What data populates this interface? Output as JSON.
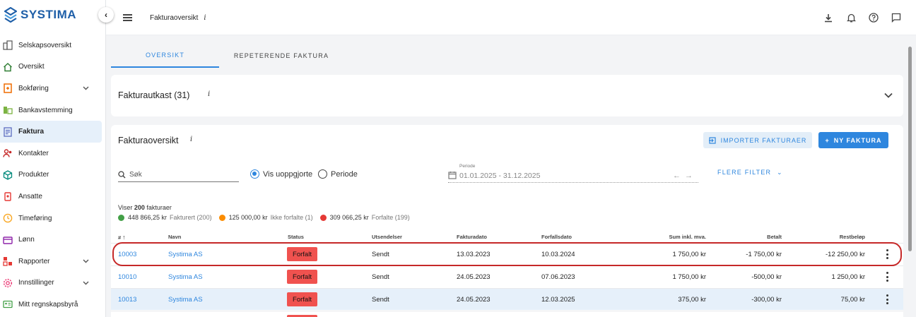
{
  "brand": {
    "name": "SYSTIMA",
    "color": "#1f5fa8"
  },
  "sidebar": {
    "collapse_icon": "chevron-left-icon",
    "items": [
      {
        "label": "Selskapsoversikt",
        "icon": "buildings-icon",
        "color": "#555555"
      },
      {
        "label": "Oversikt",
        "icon": "home-icon",
        "color": "#2e7d32"
      },
      {
        "label": "Bokføring",
        "icon": "ledger-icon",
        "color": "#ef6c00",
        "expandable": true
      },
      {
        "label": "Bankavstemming",
        "icon": "bank-icon",
        "color": "#7cb342"
      },
      {
        "label": "Faktura",
        "icon": "invoice-icon",
        "color": "#5c6bc0",
        "active": true
      },
      {
        "label": "Kontakter",
        "icon": "contacts-icon",
        "color": "#c62828"
      },
      {
        "label": "Produkter",
        "icon": "cube-icon",
        "color": "#00897b"
      },
      {
        "label": "Ansatte",
        "icon": "badge-icon",
        "color": "#e53935"
      },
      {
        "label": "Timeføring",
        "icon": "clock-icon",
        "color": "#f9a825"
      },
      {
        "label": "Lønn",
        "icon": "wallet-icon",
        "color": "#8e24aa"
      },
      {
        "label": "Rapporter",
        "icon": "report-icon",
        "color": "#e53935",
        "expandable": true
      },
      {
        "label": "Innstillinger",
        "icon": "gear-icon",
        "color": "#ec407a",
        "expandable": true
      },
      {
        "label": "Mitt regnskapsbyrå",
        "icon": "id-card-icon",
        "color": "#43a047"
      }
    ]
  },
  "topbar": {
    "title": "Fakturaoversikt",
    "info": "i",
    "icons": [
      "download-icon",
      "bell-icon",
      "help-icon",
      "chat-icon"
    ]
  },
  "tabs": [
    {
      "label": "OVERSIKT",
      "active": true
    },
    {
      "label": "REPETERENDE FAKTURA",
      "active": false
    }
  ],
  "drafts": {
    "title": "Fakturautkast (31)",
    "info": "i"
  },
  "invoices": {
    "title": "Fakturaoversikt",
    "info": "i",
    "import_label": "IMPORTER FAKTURAER",
    "new_label": "NY FAKTURA",
    "search_placeholder": "Søk",
    "radio_unsettled": "Vis uoppgjorte",
    "radio_period": "Periode",
    "period_label": "Periode",
    "period_value": "01.01.2025 - 31.12.2025",
    "more_filter": "FLERE FILTER",
    "showing_prefix": "Viser",
    "showing_count": "200",
    "showing_suffix": "fakturaer",
    "summary": [
      {
        "amount": "448 866,25 kr",
        "label": "Fakturert (200)",
        "color": "#43a047"
      },
      {
        "amount": "125 000,00 kr",
        "label": "Ikke forfalte (1)",
        "color": "#fb8c00"
      },
      {
        "amount": "309 066,25 kr",
        "label": "Forfalte (199)",
        "color": "#e53935"
      }
    ],
    "columns": {
      "number": "#",
      "name": "Navn",
      "status": "Status",
      "sent": "Utsendelser",
      "invoice_date": "Fakturadato",
      "due_date": "Forfallsdato",
      "sum": "Sum inkl. mva.",
      "paid": "Betalt",
      "remaining": "Restbeløp"
    },
    "rows": [
      {
        "number": "10003",
        "name": "Systima AS",
        "status": "Forfalt",
        "sent": "Sendt",
        "invoice_date": "13.03.2023",
        "due_date": "10.03.2024",
        "sum": "1 750,00 kr",
        "paid": "-1 750,00 kr",
        "remaining": "-12 250,00 kr"
      },
      {
        "number": "10010",
        "name": "Systima AS",
        "status": "Forfalt",
        "sent": "Sendt",
        "invoice_date": "24.05.2023",
        "due_date": "07.06.2023",
        "sum": "1 750,00 kr",
        "paid": "-500,00 kr",
        "remaining": "1 250,00 kr"
      },
      {
        "number": "10013",
        "name": "Systima AS",
        "status": "Forfalt",
        "sent": "Sendt",
        "invoice_date": "24.05.2023",
        "due_date": "12.03.2025",
        "sum": "375,00 kr",
        "paid": "-300,00 kr",
        "remaining": "75,00 kr"
      }
    ]
  }
}
